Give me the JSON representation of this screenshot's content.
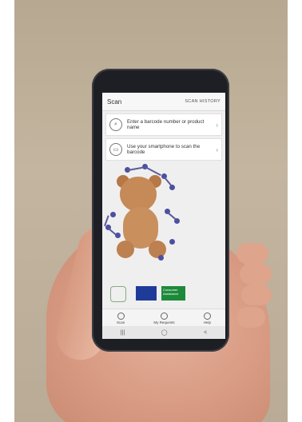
{
  "app": {
    "header": {
      "title": "Scan",
      "history": "SCAN HISTORY"
    },
    "cards": [
      {
        "icon": "search-barcode-icon",
        "label": "Enter a barcode number or product name"
      },
      {
        "icon": "camera-scan-icon",
        "label": "Use your smartphone to scan the barcode"
      }
    ],
    "logo_text": "Consumer Assistance",
    "bottom_nav": [
      {
        "label": "Scan",
        "icon": "scan-icon"
      },
      {
        "label": "My Requests",
        "icon": "requests-icon"
      },
      {
        "label": "Help",
        "icon": "help-icon"
      }
    ],
    "system_nav": [
      "|||",
      "◯",
      "<"
    ]
  }
}
